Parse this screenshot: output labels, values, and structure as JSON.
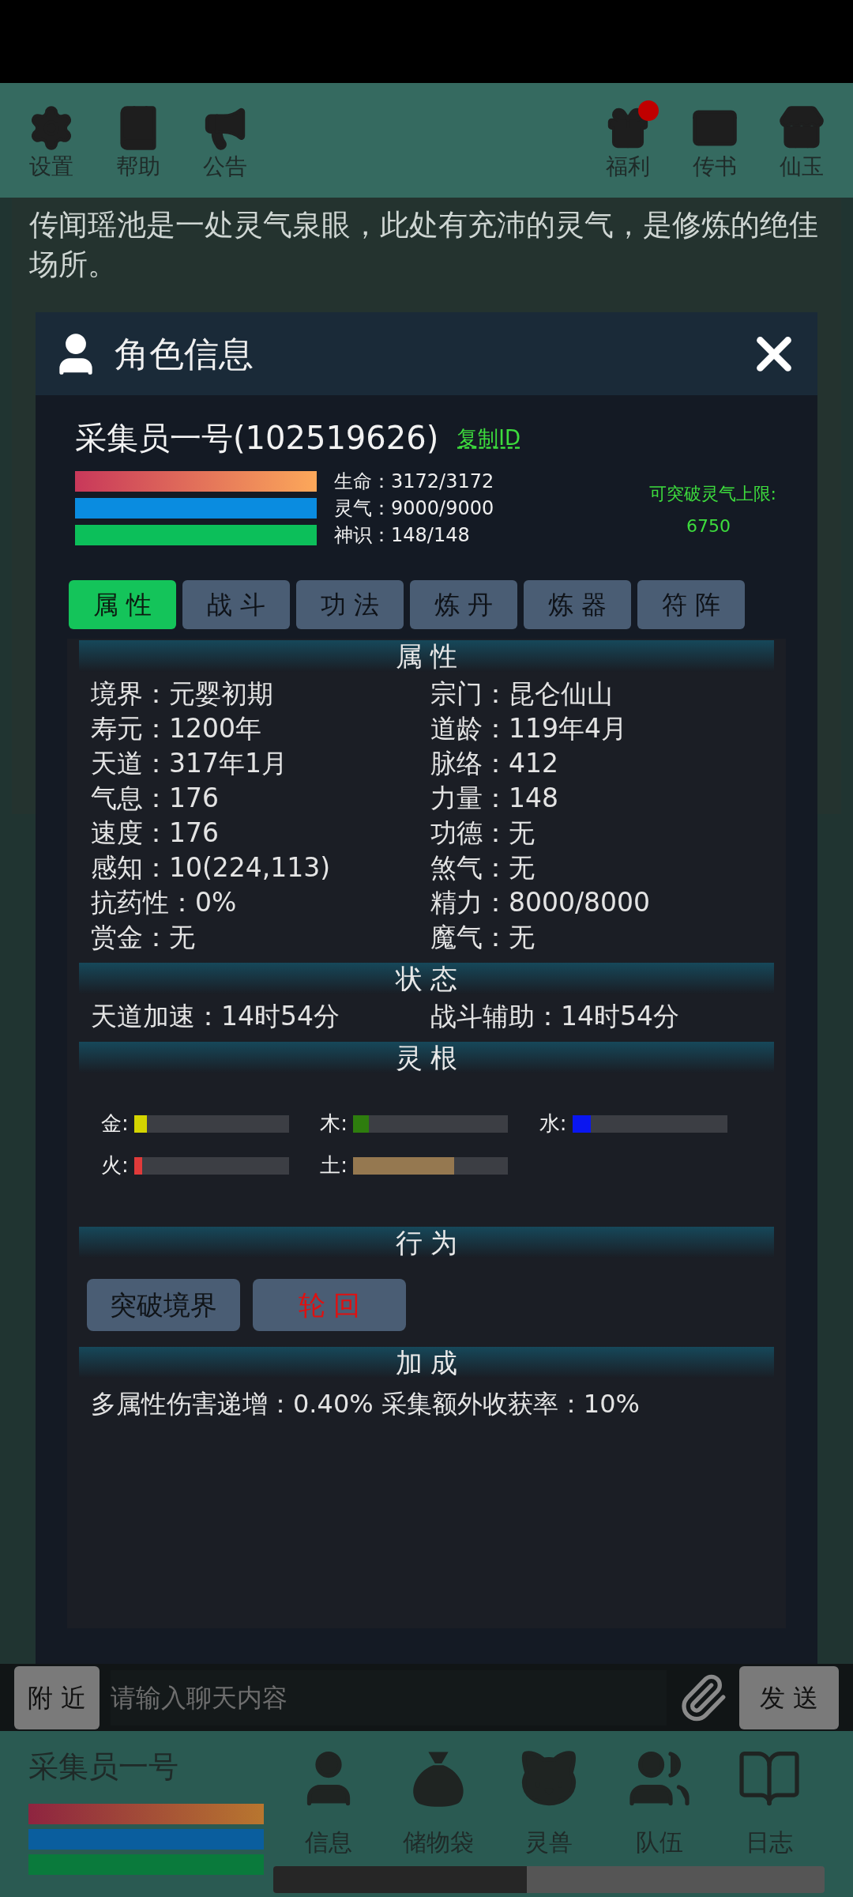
{
  "top_bar": {
    "left": [
      {
        "label": "设置",
        "badge": false
      },
      {
        "label": "帮助",
        "badge": false
      },
      {
        "label": "公告",
        "badge": false
      }
    ],
    "right": [
      {
        "label": "福利",
        "badge": true
      },
      {
        "label": "传书",
        "badge": false
      },
      {
        "label": "仙玉",
        "badge": false
      }
    ]
  },
  "description": "传闻瑶池是一处灵气泉眼，此处有充沛的灵气，是修炼的绝佳场所。",
  "dialog": {
    "title": "角色信息",
    "name": "采集员一号(102519626)",
    "copy_link": "复制ID",
    "bars": [
      {
        "kind": "hp",
        "label": "生命：3172/3172",
        "level": 1
      },
      {
        "kind": "mp",
        "label": "灵气：9000/9000",
        "level": 1
      },
      {
        "kind": "sense",
        "label": "神识：148/148",
        "level": 1
      }
    ],
    "breakthrough": {
      "label": "可突破灵气上限:",
      "value": "6750"
    },
    "tabs": [
      {
        "label": "属 性",
        "selected": true
      },
      {
        "label": "战 斗",
        "selected": false
      },
      {
        "label": "功 法",
        "selected": false
      },
      {
        "label": "炼 丹",
        "selected": false
      },
      {
        "label": "炼 器",
        "selected": false
      },
      {
        "label": "符 阵",
        "selected": false
      }
    ],
    "sections": [
      {
        "kind": "stats",
        "title": "属 性",
        "items": [
          "境界：元婴初期",
          "宗门：昆仑仙山",
          "寿元：1200年",
          "道龄：119年4月",
          "天道：317年1月",
          "脉络：412",
          "气息：176",
          "力量：148",
          "速度：176",
          "功德：无",
          "感知：10(224,113)",
          "煞气：无",
          "抗药性：0%",
          "精力：8000/8000",
          "赏金：无",
          "魔气：无"
        ]
      },
      {
        "kind": "stats",
        "title": "状 态",
        "items": [
          "天道加速：14时54分",
          "战斗辅助：14时54分"
        ]
      },
      {
        "kind": "roots",
        "title": "灵 根",
        "roots": [
          {
            "label": "金:",
            "level": 0.08,
            "color": "#d4d400"
          },
          {
            "label": "木:",
            "level": 0.1,
            "color": "#2e7d0e"
          },
          {
            "label": "水:",
            "level": 0.12,
            "color": "#0a16f0"
          },
          {
            "label": "火:",
            "level": 0.05,
            "color": "#e03a3a"
          },
          {
            "label": "土:",
            "level": 0.65,
            "color": "#957850"
          }
        ]
      },
      {
        "kind": "actions",
        "title": "行 为",
        "buttons": [
          {
            "label": "突破境界",
            "danger": false
          },
          {
            "label": "轮 回",
            "danger": true
          }
        ]
      },
      {
        "kind": "text",
        "title": "加 成",
        "text": "多属性伤害递增：0.40% 采集额外收获率：10%"
      }
    ]
  },
  "chat": {
    "channel": "附 近",
    "placeholder": "请输入聊天内容",
    "send": "发 送"
  },
  "bottom": {
    "name": "采集员一号",
    "bars": [
      {
        "kind": "hp",
        "level": 1
      },
      {
        "kind": "mp",
        "level": 1
      },
      {
        "kind": "sense",
        "level": 1
      }
    ],
    "nav": [
      {
        "label": "信息"
      },
      {
        "label": "储物袋"
      },
      {
        "label": "灵兽"
      },
      {
        "label": "队伍"
      },
      {
        "label": "日志"
      }
    ],
    "progress": {
      "level": 0.46
    }
  }
}
